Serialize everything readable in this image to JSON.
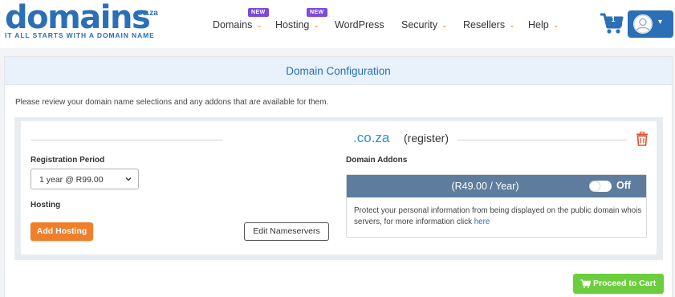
{
  "brand": {
    "logo_text": "domains",
    "logo_suffix": ".co.za",
    "tagline": "IT ALL STARTS WITH A DOMAIN NAME",
    "color": "#2b6fb6"
  },
  "nav": {
    "items": [
      {
        "label": "Domains",
        "badge": "NEW",
        "has_dropdown": true
      },
      {
        "label": "Hosting",
        "badge": "NEW",
        "has_dropdown": true
      },
      {
        "label": "WordPress",
        "has_dropdown": false
      },
      {
        "label": "Security",
        "has_dropdown": true
      },
      {
        "label": "Resellers",
        "has_dropdown": true
      },
      {
        "label": "Help",
        "has_dropdown": true
      }
    ],
    "cart_count": "1",
    "icons": {
      "cart": "shopping-cart-icon",
      "user": "user-avatar-icon",
      "dropdown": "chevron-down-icon"
    }
  },
  "page": {
    "title": "Domain Configuration",
    "intro": "Please review your domain name selections and any addons that are available for them."
  },
  "domain": {
    "name": ".co.za",
    "action": "(register)",
    "registration_label": "Registration Period",
    "registration_value": "1 year @ R99.00",
    "hosting_label": "Hosting",
    "add_hosting_label": "Add Hosting",
    "edit_nameservers_label": "Edit Nameservers",
    "addons_label": "Domain Addons"
  },
  "addon": {
    "price": "(R49.00 / Year)",
    "toggle_state": "Off",
    "description": "Protect your personal information from being displayed on the public domain whois servers, for more information click",
    "link_text": "here"
  },
  "actions": {
    "proceed_label": "Proceed to Cart"
  },
  "colors": {
    "accent_orange": "#f07f2c",
    "addon_header": "#5e7d9e",
    "proceed_green": "#6bcf3d",
    "trash_red": "#e0532f"
  }
}
